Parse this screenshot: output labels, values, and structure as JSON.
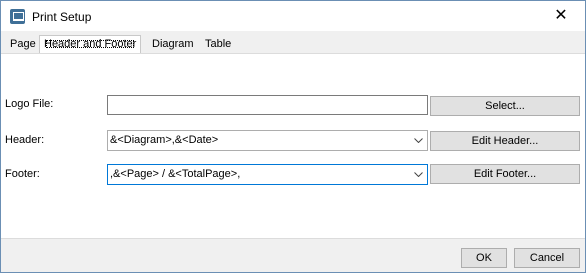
{
  "window": {
    "title": "Print Setup",
    "close_glyph": "✕",
    "icon": "print-setup-app-icon"
  },
  "tabs": [
    {
      "label": "Page",
      "active": false
    },
    {
      "label": "Header and Footer",
      "active": true
    },
    {
      "label": "Diagram",
      "active": false
    },
    {
      "label": "Table",
      "active": false
    }
  ],
  "logo": {
    "label": "Logo File:",
    "value": "",
    "button_label": "Select..."
  },
  "header": {
    "label": "Header:",
    "value": "&<Diagram>,&<Date>",
    "button_label": "Edit Header..."
  },
  "footer": {
    "label": "Footer:",
    "value": ",&<Page> / &<TotalPage>,",
    "button_label": "Edit Footer..."
  },
  "dialog_buttons": {
    "ok_label": "OK",
    "cancel_label": "Cancel"
  },
  "colors": {
    "focus_border": "#0078d7",
    "button_face": "#e1e1e1"
  }
}
